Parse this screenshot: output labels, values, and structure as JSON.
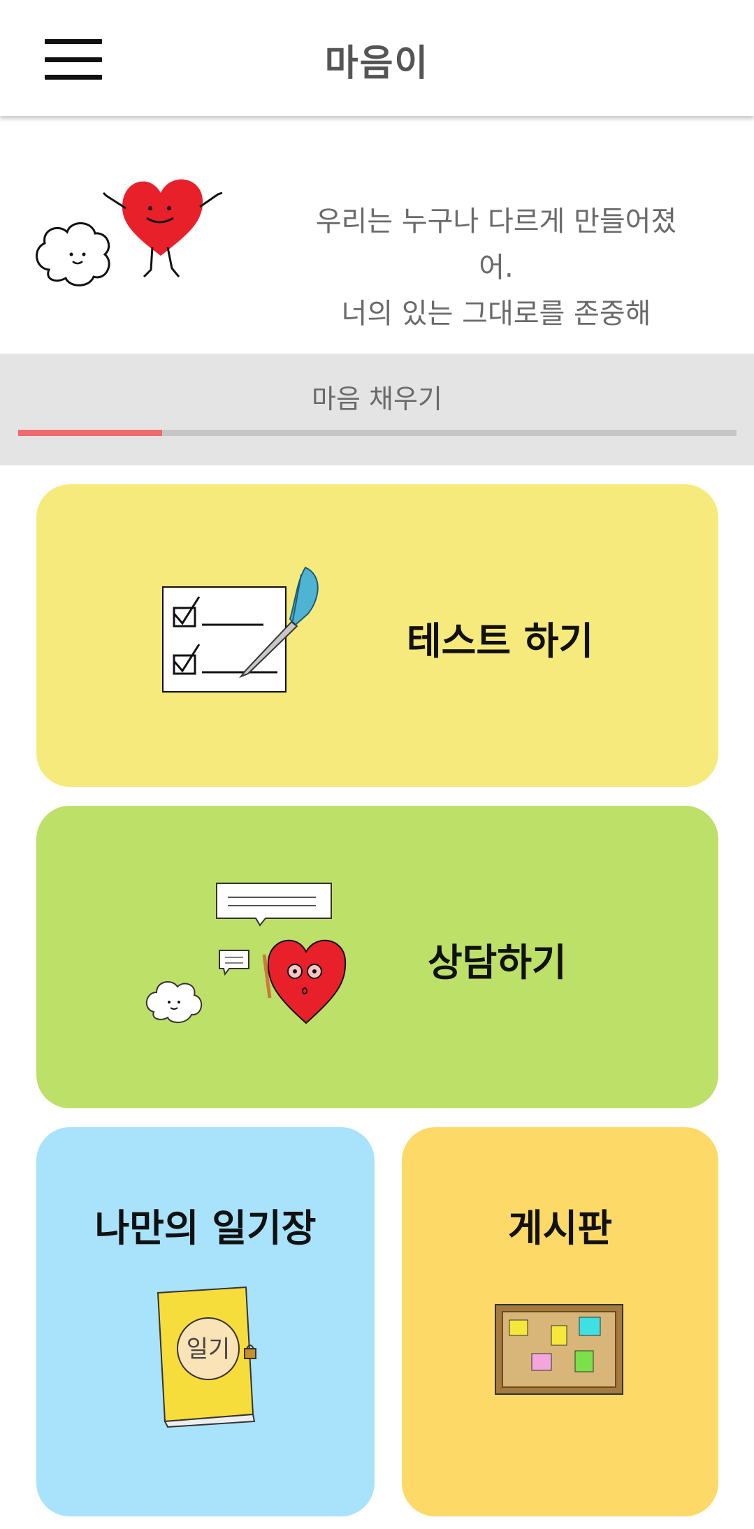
{
  "app_bar": {
    "title": "마음이",
    "menu_icon": "hamburger-menu-icon"
  },
  "hero": {
    "line1": "우리는 누구나 다르게 만들어졌어.",
    "line2": "너의 있는 그대로를 존중해",
    "illustration": "heart-and-cloud-icon"
  },
  "progress": {
    "label": "마음 채우기",
    "value": 0.2,
    "fill_color": "#f06a6e",
    "track_color": "#c6c6c6"
  },
  "cards": {
    "test": {
      "label": "테스트 하기",
      "icon": "checklist-pen-icon",
      "color": "#f7ea7d"
    },
    "counsel": {
      "label": "상담하기",
      "icon": "heart-chat-icon",
      "color": "#bde069"
    },
    "diary": {
      "label": "나만의 일기장",
      "icon": "diary-book-icon",
      "book_text": "일기",
      "color": "#a9e2fb"
    },
    "board": {
      "label": "게시판",
      "icon": "bulletin-board-icon",
      "color": "#fdd968"
    }
  }
}
